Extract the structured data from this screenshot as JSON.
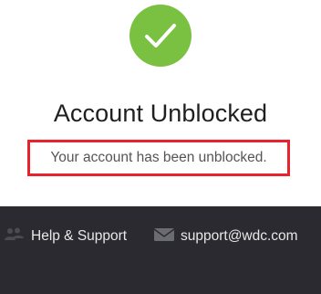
{
  "status": {
    "title": "Account Unblocked",
    "message": "Your account has been unblocked.",
    "icon": "check-icon",
    "accent_color": "#7ac142",
    "highlight_color": "#e8232e"
  },
  "footer": {
    "help_label": "Help & Support",
    "help_icon": "users-icon",
    "email": "support@wdc.com",
    "email_icon": "envelope-icon"
  }
}
